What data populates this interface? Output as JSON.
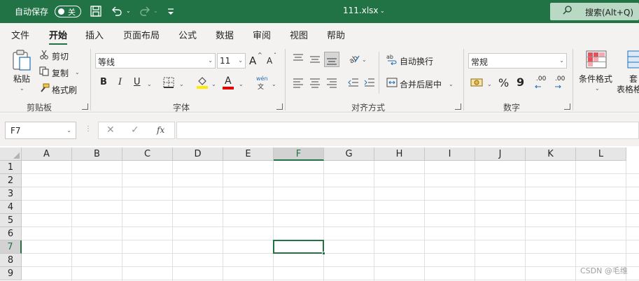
{
  "title_bar": {
    "autosave_label": "自动保存",
    "autosave_state": "关",
    "filename": "111.xlsx",
    "filename_caret": "⌄",
    "search_label": "搜索(Alt+Q)",
    "qat_caret": "⌄"
  },
  "tabs": [
    "文件",
    "开始",
    "插入",
    "页面布局",
    "公式",
    "数据",
    "审阅",
    "视图",
    "帮助"
  ],
  "active_tab": "开始",
  "ribbon": {
    "clipboard": {
      "paste_label": "粘贴",
      "cut_label": "剪切",
      "copy_label": "复制",
      "format_painter_label": "格式刷",
      "group_label": "剪贴板"
    },
    "font": {
      "font_name": "等线",
      "font_size": "11",
      "grow_label": "A",
      "shrink_label": "A",
      "bold": "B",
      "italic": "I",
      "underline": "U",
      "font_color_glyph": "A",
      "phonetic_glyph": "wén",
      "phonetic_sub": "文",
      "group_label": "字体",
      "fill_color": "#ffea00",
      "font_color": "#e00000"
    },
    "alignment": {
      "wrap_label": "自动换行",
      "merge_label": "合并后居中",
      "group_label": "对齐方式"
    },
    "number": {
      "format_value": "常规",
      "percent": "%",
      "comma": "9",
      "inc_decimal": ".00",
      "group_label": "数字"
    },
    "styles": {
      "conditional_label": "条件格式",
      "table_label_1": "套",
      "table_label_2": "表格格"
    }
  },
  "formula_bar": {
    "name_box": "F7",
    "fx": "fx",
    "formula": ""
  },
  "sheet": {
    "columns": [
      "A",
      "B",
      "C",
      "D",
      "E",
      "F",
      "G",
      "H",
      "I",
      "J",
      "K",
      "L"
    ],
    "rows": [
      "1",
      "2",
      "3",
      "4",
      "5",
      "6",
      "7",
      "8",
      "9"
    ],
    "selected_cell": "F7",
    "selected_column": "F",
    "selected_row": "7"
  },
  "watermark": "CSDN @毛维",
  "colors": {
    "brand": "#217346",
    "ribbon_bg": "#f3f2f1",
    "search_bg": "#b9d9c4"
  }
}
